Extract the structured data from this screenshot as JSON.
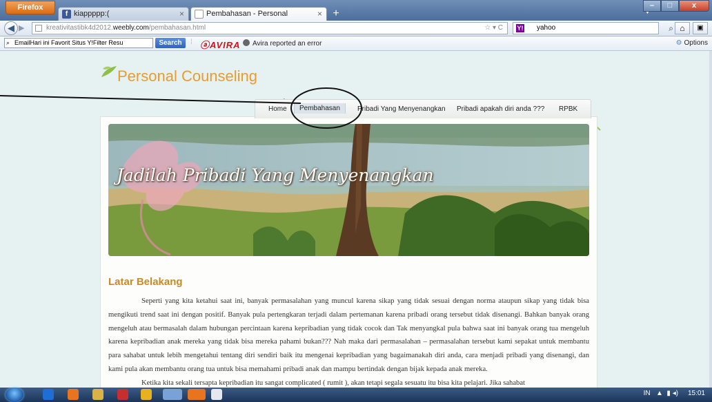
{
  "browser": {
    "firefox_button": "Firefox",
    "tabs": [
      {
        "label": "kiappppp:(",
        "close": "×"
      },
      {
        "label": "Pembahasan - Personal Counseling",
        "close": "×"
      }
    ],
    "new_tab": "+",
    "url": {
      "prefix": "kreativitastibk4d2012.",
      "host": "weebly.com",
      "path": "/pembahasan.html"
    },
    "search_engine_text": "yahoo",
    "url_icons": "☆ ▾ C",
    "window_controls": {
      "min": "–",
      "max": "□",
      "close": "x"
    }
  },
  "toolbar2": {
    "search_text": "EmailHari ini  Favorit   Situs Y!Filter Resu",
    "search_button": "Search",
    "avira_logo": "AVIRA",
    "avira_status": "Avira reported an error",
    "options": "Options"
  },
  "site": {
    "title": "Personal Counseling",
    "nav": [
      "Home",
      "Pembahasan",
      "Pribadi Yang Menyenangkan",
      "Pribadi apakah diri anda ???",
      "RPBK"
    ],
    "banner_text": "Jadilah Pribadi Yang Menyenangkan",
    "heading": "Latar Belakang",
    "paragraphs": [
      "Seperti yang kita ketahui saat ini, banyak permasalahan yang muncul karena sikap yang tidak sesuai dengan norma ataupun sikap yang tidak bisa mengikuti trend saat ini dengan positif. Banyak pula pertengkaran terjadi dalam pertemanan karena pribadi orang tersebut tidak disenangi. Bahkan banyak orang mengeluh atau bermasalah dalam hubungan percintaan karena kepribadian yang tidak cocok dan  Tak menyangkal pula bahwa saat ini banyak orang tua mengeluh karena kepribadian anak mereka yang tidak bisa mereka pahami bukan??? Nah maka dari permasalahan – permasalahan tersebut kami sepakat untuk membantu para sahabat untuk lebih mengetahui tentang diri sendiri baik itu mengenai kepribadian yang bagaimanakah diri anda, cara menjadi pribadi yang disenangi, dan kami pula akan membantu orang tua untuk bisa memahami pribadi anak  dan mampu bertindak dengan bijak kepada anak mereka.",
      "Ketika kita sekali tersapta kepribadian itu sangat complicated ( rumit ), akan tetapi segala sesuatu itu bisa kita pelajari. Jika sahabat"
    ]
  },
  "taskbar": {
    "lang": "IN",
    "time": "15:01"
  },
  "colors": {
    "accent": "#e89c2c",
    "heading": "#c88a22",
    "avira": "#d1131b"
  }
}
